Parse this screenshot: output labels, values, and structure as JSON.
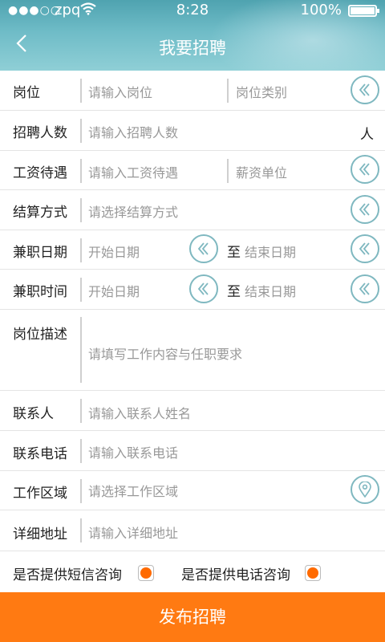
{
  "status": {
    "carrier": "zpq",
    "time": "8:28",
    "battery": "100%"
  },
  "header": {
    "title": "我要招聘"
  },
  "form": {
    "position": {
      "label": "岗位",
      "placeholder": "请输入岗位",
      "category_placeholder": "岗位类别"
    },
    "headcount": {
      "label": "招聘人数",
      "placeholder": "请输入招聘人数",
      "unit": "人"
    },
    "salary": {
      "label": "工资待遇",
      "placeholder": "请输入工资待遇",
      "unit_placeholder": "薪资单位"
    },
    "settlement": {
      "label": "结算方式",
      "placeholder": "请选择结算方式"
    },
    "date": {
      "label": "兼职日期",
      "start_placeholder": "开始日期",
      "to": "至",
      "end_placeholder": "结束日期"
    },
    "time": {
      "label": "兼职时间",
      "start_placeholder": "开始日期",
      "to": "至",
      "end_placeholder": "结束日期"
    },
    "description": {
      "label": "岗位描述",
      "placeholder": "请填写工作内容与任职要求"
    },
    "contact": {
      "label": "联系人",
      "placeholder": "请输入联系人姓名"
    },
    "phone": {
      "label": "联系电话",
      "placeholder": "请输入联系电话"
    },
    "area": {
      "label": "工作区域",
      "placeholder": "请选择工作区域"
    },
    "address": {
      "label": "详细地址",
      "placeholder": "请输入详细地址"
    },
    "sms_consult": {
      "label": "是否提供短信咨询",
      "checked": true
    },
    "phone_consult": {
      "label": "是否提供电话咨询",
      "checked": true
    }
  },
  "submit_label": "发布招聘",
  "colors": {
    "accent": "#ff7a12",
    "header": "#6fbcc7",
    "icon_ring": "#7fb8c0"
  },
  "icons": {
    "dropdown": "chevron-left-icon",
    "location": "location-pin-icon",
    "back": "back-arrow-icon"
  }
}
